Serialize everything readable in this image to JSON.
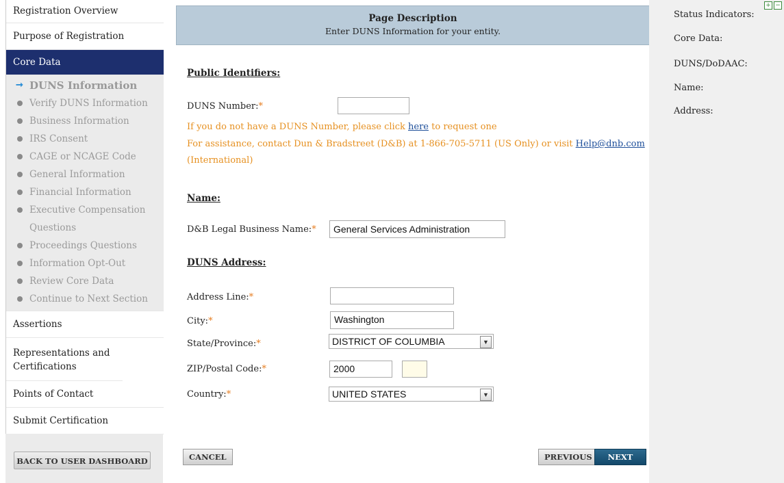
{
  "nav": {
    "registration_overview": "Registration Overview",
    "purpose_of_registration": "Purpose of Registration",
    "core_data": "Core Data",
    "sub_items": [
      "DUNS Information",
      "Verify DUNS Information",
      "Business Information",
      "IRS Consent",
      "CAGE or NCAGE Code",
      "General Information",
      "Financial Information",
      "Executive Compensation Questions",
      "Proceedings Questions",
      "Information Opt-Out",
      "Review Core Data",
      "Continue to Next Section"
    ],
    "assertions": "Assertions",
    "reps_and_certs": "Representations and Certifications",
    "points_of_contact": "Points of Contact",
    "submit_certification": "Submit Certification",
    "back_button": "BACK TO USER DASHBOARD"
  },
  "page_description": {
    "title": "Page Description",
    "text": "Enter DUNS Information for your entity."
  },
  "public_identifiers": {
    "heading": "Public Identifiers:",
    "duns_label": "DUNS Number:",
    "duns_value": "",
    "help_prefix": "If you do not have a DUNS Number, please click ",
    "help_link": "here",
    "help_suffix": " to request one",
    "assist_text": "For assistance, contact Dun & Bradstreet (D&B) at 1-866-705-5711 (US Only) or visit ",
    "assist_link": "Help@dnb.com",
    "assist_suffix": "(International)"
  },
  "name_section": {
    "heading": "Name:",
    "legal_name_label": "D&B Legal Business Name:",
    "legal_name_value": "General Services Administration"
  },
  "address_section": {
    "heading": "DUNS Address:",
    "address_line_label": "Address Line:",
    "address_line_value": "",
    "city_label": "City:",
    "city_value": "Washington",
    "state_label": "State/Province:",
    "state_value": "DISTRICT OF COLUMBIA",
    "zip_label": "ZIP/Postal Code:",
    "zip_value": "2000",
    "zip_ext_value": "",
    "country_label": "Country:",
    "country_value": "UNITED STATES"
  },
  "required_marker": "*",
  "buttons": {
    "cancel": "CANCEL",
    "previous": "PREVIOUS",
    "next": "NEXT"
  },
  "status_panel": {
    "title": "Status Indicators:",
    "core_data": "Core Data:",
    "duns_dodaac": "DUNS/DoDAAC:",
    "name": "Name:",
    "address": "Address:"
  }
}
